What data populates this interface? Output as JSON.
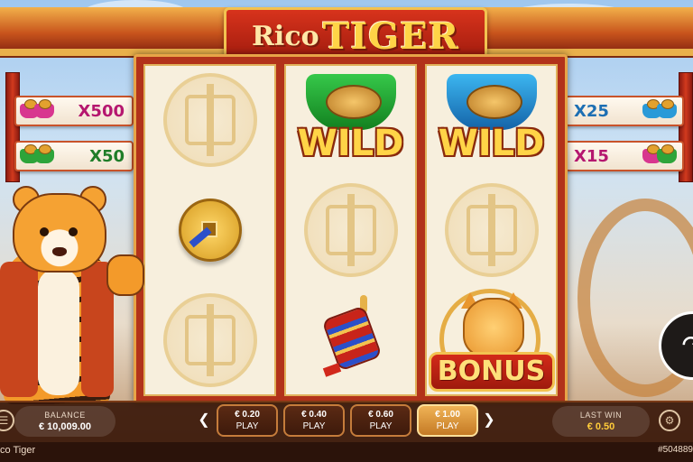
{
  "logo": {
    "part1": "Rico",
    "part2": "TIGER"
  },
  "paytable_left": [
    {
      "multiplier": "X500",
      "ingot_color": "#d8368f"
    },
    {
      "multiplier": "X50",
      "ingot_color": "#2ea43a"
    }
  ],
  "paytable_right": [
    {
      "multiplier": "X25",
      "ingot_color": "#2a9ad8"
    },
    {
      "multiplier": "X15",
      "ingot_color": "#d8368f"
    }
  ],
  "reels": [
    [
      "coin-blank",
      "gold-coin",
      "coin-blank"
    ],
    [
      "wild-green",
      "coin-blank",
      "prayer-wheel"
    ],
    [
      "wild-blue",
      "coin-blank",
      "bonus-cat"
    ]
  ],
  "symbols": {
    "wild": "WILD",
    "bonus": "BONUS"
  },
  "balance": {
    "label": "BALANCE",
    "value": "€ 10,009.00"
  },
  "bets": [
    {
      "amount": "€ 0.20",
      "action": "PLAY",
      "active": false
    },
    {
      "amount": "€ 0.40",
      "action": "PLAY",
      "active": false
    },
    {
      "amount": "€ 0.60",
      "action": "PLAY",
      "active": false
    },
    {
      "amount": "€ 1.00",
      "action": "PLAY",
      "active": true
    }
  ],
  "last_win": {
    "label": "LAST WIN",
    "value": "€ 0.50"
  },
  "footer": {
    "game_name": "co Tiger",
    "session": "#504889"
  },
  "colors": {
    "accent": "#f0b356",
    "frame": "#b2321a",
    "win": "#ffcc3a"
  },
  "icons": [
    "chevron-left-icon",
    "chevron-right-icon",
    "settings-icon",
    "spin-icon"
  ]
}
